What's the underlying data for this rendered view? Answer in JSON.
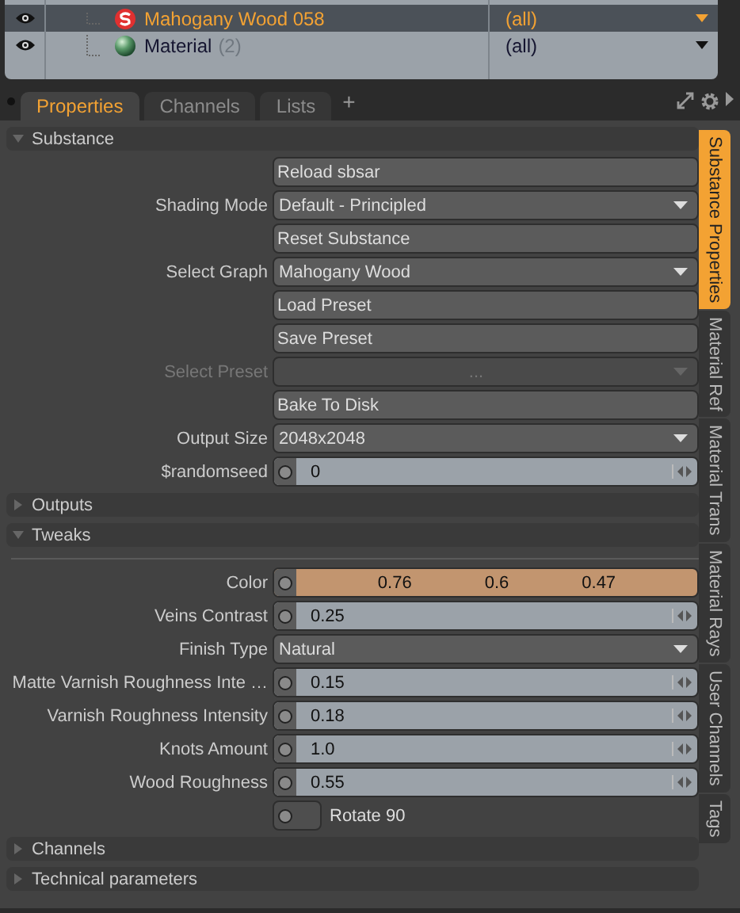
{
  "shader_tree": {
    "rows": [
      {
        "kind": "substance",
        "name": "Mahogany Wood 058",
        "effect": "(all)",
        "selected": true
      },
      {
        "kind": "material",
        "name": "Material",
        "count": "(2)",
        "effect": "(all)",
        "selected": false
      }
    ]
  },
  "tabs": [
    {
      "label": "Properties",
      "selected": true
    },
    {
      "label": "Channels",
      "selected": false
    },
    {
      "label": "Lists",
      "selected": false
    }
  ],
  "add_tab": "+",
  "sections": [
    {
      "title": "Substance",
      "expanded": true,
      "controls": [
        {
          "kind": "button",
          "label": "Reload sbsar"
        },
        {
          "kind": "dropdown",
          "label": "Shading Mode",
          "value": "Default - Principled",
          "disabled": false
        },
        {
          "kind": "button",
          "label": "Reset Substance"
        },
        {
          "kind": "dropdown",
          "label": "Select Graph",
          "value": "Mahogany Wood",
          "disabled": false
        },
        {
          "kind": "button",
          "label": "Load Preset"
        },
        {
          "kind": "button",
          "label": "Save Preset"
        },
        {
          "kind": "dropdown",
          "label": "Select Preset",
          "value": "...",
          "disabled": true
        },
        {
          "kind": "button",
          "label": "Bake To Disk"
        },
        {
          "kind": "dropdown",
          "label": "Output Size",
          "value": "2048x2048",
          "disabled": false
        },
        {
          "kind": "number",
          "label": "$randomseed",
          "value": "0"
        }
      ]
    },
    {
      "title": "Outputs",
      "expanded": false
    },
    {
      "title": "Tweaks",
      "expanded": true,
      "separator": true,
      "controls": [
        {
          "kind": "color",
          "label": "Color",
          "values": [
            "0.76",
            "0.6",
            "0.47"
          ],
          "color": "#c2956f"
        },
        {
          "kind": "number",
          "label": "Veins Contrast",
          "value": "0.25"
        },
        {
          "kind": "dropdown",
          "label": "Finish Type",
          "value": "Natural",
          "disabled": false
        },
        {
          "kind": "number",
          "label": "Matte Varnish Roughness Inte …",
          "value": "0.15"
        },
        {
          "kind": "number",
          "label": "Varnish Roughness Intensity",
          "value": "0.18"
        },
        {
          "kind": "number",
          "label": "Knots Amount",
          "value": "1.0"
        },
        {
          "kind": "number",
          "label": "Wood Roughness",
          "value": "0.55"
        },
        {
          "kind": "toggle",
          "text": "Rotate 90",
          "checked": false
        }
      ]
    },
    {
      "title": "Channels",
      "expanded": false
    },
    {
      "title": "Technical parameters",
      "expanded": false
    }
  ],
  "side_tabs": [
    {
      "label": "Substance Properties",
      "selected": true
    },
    {
      "label": "Material Ref",
      "selected": false
    },
    {
      "label": "Material Trans",
      "selected": false
    },
    {
      "label": "Material Rays",
      "selected": false
    },
    {
      "label": "User Channels",
      "selected": false
    },
    {
      "label": "Tags",
      "selected": false
    }
  ]
}
